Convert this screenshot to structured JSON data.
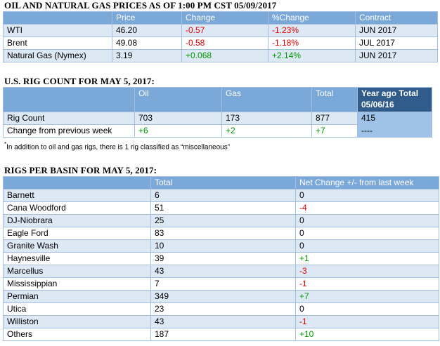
{
  "prices": {
    "title": "OIL AND NATURAL GAS PRICES AS OF 1:00 PM CST 05/09/2017",
    "headers": [
      "",
      "Price",
      "Change",
      "%Change",
      "Contract"
    ],
    "rows": [
      {
        "name": "WTI",
        "price": "46.20",
        "change": "-0.57",
        "pct": "-1.23%",
        "contract": "JUN 2017"
      },
      {
        "name": "Brent",
        "price": "49.08",
        "change": "-0.58",
        "pct": "-1.18%",
        "contract": "JUL 2017"
      },
      {
        "name": "Natural Gas (Nymex)",
        "price": "3.19",
        "change": "+0.068",
        "pct": "+2.14%",
        "contract": "JUN 2017"
      }
    ]
  },
  "rigs": {
    "title": "U.S. RIG COUNT FOR MAY 5, 2017:",
    "headers": [
      "",
      "Oil",
      "Gas",
      "Total",
      "Year ago Total 05/06/16"
    ],
    "rows": [
      {
        "label": "Rig Count",
        "oil": "703",
        "gas": "173",
        "total": "877",
        "yearago": "415"
      },
      {
        "label": "Change from previous week",
        "oil": "+6",
        "gas": "+2",
        "total": "+7",
        "yearago": "----"
      }
    ],
    "footnote_mark": "*",
    "footnote": "In addition to oil and gas rigs, there is 1 rig classified as “miscellaneous”"
  },
  "basins": {
    "title": "RIGS PER BASIN FOR MAY 5, 2017:",
    "headers": [
      "",
      "Total",
      "Net Change +/- from last week"
    ],
    "rows": [
      {
        "name": "Barnett",
        "total": "6",
        "change": "0"
      },
      {
        "name": "Cana Woodford",
        "total": "51",
        "change": "-4"
      },
      {
        "name": "DJ-Niobrara",
        "total": "25",
        "change": "0"
      },
      {
        "name": "Eagle Ford",
        "total": "83",
        "change": "0"
      },
      {
        "name": "Granite Wash",
        "total": "10",
        "change": "0"
      },
      {
        "name": "Haynesville",
        "total": "39",
        "change": "+1"
      },
      {
        "name": "Marcellus",
        "total": "43",
        "change": "-3"
      },
      {
        "name": "Mississippian",
        "total": "7",
        "change": "-1"
      },
      {
        "name": "Permian",
        "total": "349",
        "change": "+7"
      },
      {
        "name": "Utica",
        "total": "23",
        "change": "0"
      },
      {
        "name": "Williston",
        "total": "43",
        "change": "-1"
      },
      {
        "name": "Others",
        "total": "187",
        "change": "+10"
      }
    ]
  },
  "colors": {
    "header_bg": "#7aa8d8",
    "stripe_bg": "#dde8f5",
    "border": "#a6bedd",
    "negative": "#e00000",
    "positive": "#009900",
    "yearago_header": "#2f5c8a",
    "yearago_cell": "#9fc3e8"
  }
}
